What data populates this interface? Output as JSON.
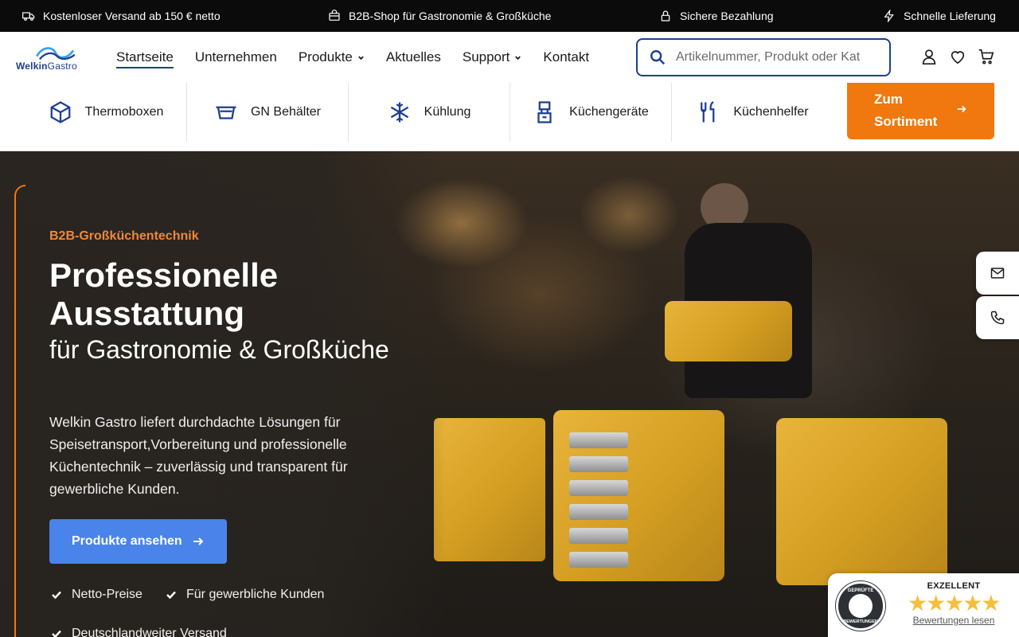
{
  "topbar": {
    "items": [
      {
        "icon": "truck-icon",
        "label": "Kostenloser Versand ab 150 € netto"
      },
      {
        "icon": "shop-icon",
        "label": "B2B-Shop für Gastronomie & Großküche"
      },
      {
        "icon": "lock-icon",
        "label": "Sichere Bezahlung"
      },
      {
        "icon": "bolt-icon",
        "label": "Schnelle Lieferung"
      }
    ]
  },
  "header": {
    "logo": {
      "word1": "Welkin",
      "word2": "Gastro"
    },
    "nav": [
      {
        "label": "Startseite",
        "active": true
      },
      {
        "label": "Unternehmen"
      },
      {
        "label": "Produkte",
        "dropdown": true
      },
      {
        "label": "Aktuelles"
      },
      {
        "label": "Support",
        "dropdown": true
      },
      {
        "label": "Kontakt"
      }
    ],
    "search": {
      "placeholder": "Artikelnummer, Produkt oder Kat"
    },
    "icons": [
      "user-icon",
      "heart-icon",
      "cart-icon"
    ]
  },
  "categories": [
    {
      "icon": "box-icon",
      "label": "Thermoboxen"
    },
    {
      "icon": "gn-container-icon",
      "label": "GN Behälter"
    },
    {
      "icon": "snowflake-icon",
      "label": "Kühlung"
    },
    {
      "icon": "appliance-icon",
      "label": "Küchengeräte"
    },
    {
      "icon": "utensils-icon",
      "label": "Küchenhelfer"
    }
  ],
  "category_cta": {
    "line1": "Zum",
    "line2": "Sortiment"
  },
  "hero": {
    "eyebrow": "B2B-Großküchentechnik",
    "title": "Professionelle Ausstattung",
    "subtitle": "für Gastronomie & Großküche",
    "lead": "Welkin Gastro liefert durchdachte Lösungen für Speisetransport,Vorbereitung und professionelle Küchentechnik – zuverlässig und transparent für gewerbliche Kunden.",
    "cta_label": "Produkte ansehen",
    "checks": [
      "Netto-Preise",
      "Für gewerbliche Kunden",
      "Deutschlandweiter Versand"
    ]
  },
  "side_contact": [
    "mail-icon",
    "phone-icon"
  ],
  "trust_badge": {
    "seal_top": "GEPRÜFTE",
    "seal_bottom": "BEWERTUNGEN",
    "rating_label": "EXZELLENT",
    "stars": "★★★★★",
    "link": "Bewertungen lesen",
    "star_color": "#f5bf3c"
  },
  "colors": {
    "brand_blue": "#1c3f8f",
    "accent_orange": "#f0780e",
    "cta_blue": "#4a84ea"
  }
}
